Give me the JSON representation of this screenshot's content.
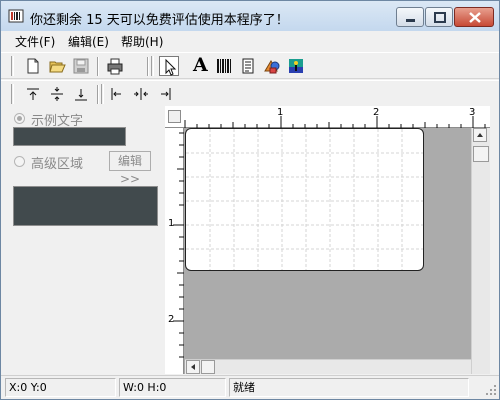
{
  "window": {
    "title": "你还剩余 15 天可以免费评估使用本程序了！"
  },
  "menu": {
    "items": [
      {
        "label": "文件(F)"
      },
      {
        "label": "编辑(E)"
      },
      {
        "label": "帮助(H)"
      }
    ]
  },
  "toolbar1": {
    "icons": [
      "new-file-icon",
      "open-folder-icon",
      "save-icon",
      "print-icon",
      "pointer-icon",
      "text-tool-icon",
      "barcode-icon",
      "document-icon",
      "shapes-icon",
      "image-icon"
    ],
    "text_tool_glyph": "A"
  },
  "toolbar2": {
    "icons": [
      "align-top-icon",
      "align-middle-icon",
      "align-bottom-icon",
      "align-left-icon",
      "align-center-icon",
      "align-right-icon"
    ]
  },
  "left_panel": {
    "sample_text_label": "示例文字",
    "sample_text_selected": true,
    "advanced_area_label": "高级区域",
    "advanced_area_selected": false,
    "edit_button_label": "编辑>>"
  },
  "rulers": {
    "horizontal_labels": [
      "1",
      "2",
      "3"
    ],
    "vertical_labels": [
      "1",
      "2"
    ]
  },
  "status": {
    "coords": "X:0    Y:0",
    "size": "W:0    H:0",
    "state": "就绪"
  },
  "colors": {
    "canvas_bg": "#ababab",
    "dark_field": "#414a4d"
  }
}
